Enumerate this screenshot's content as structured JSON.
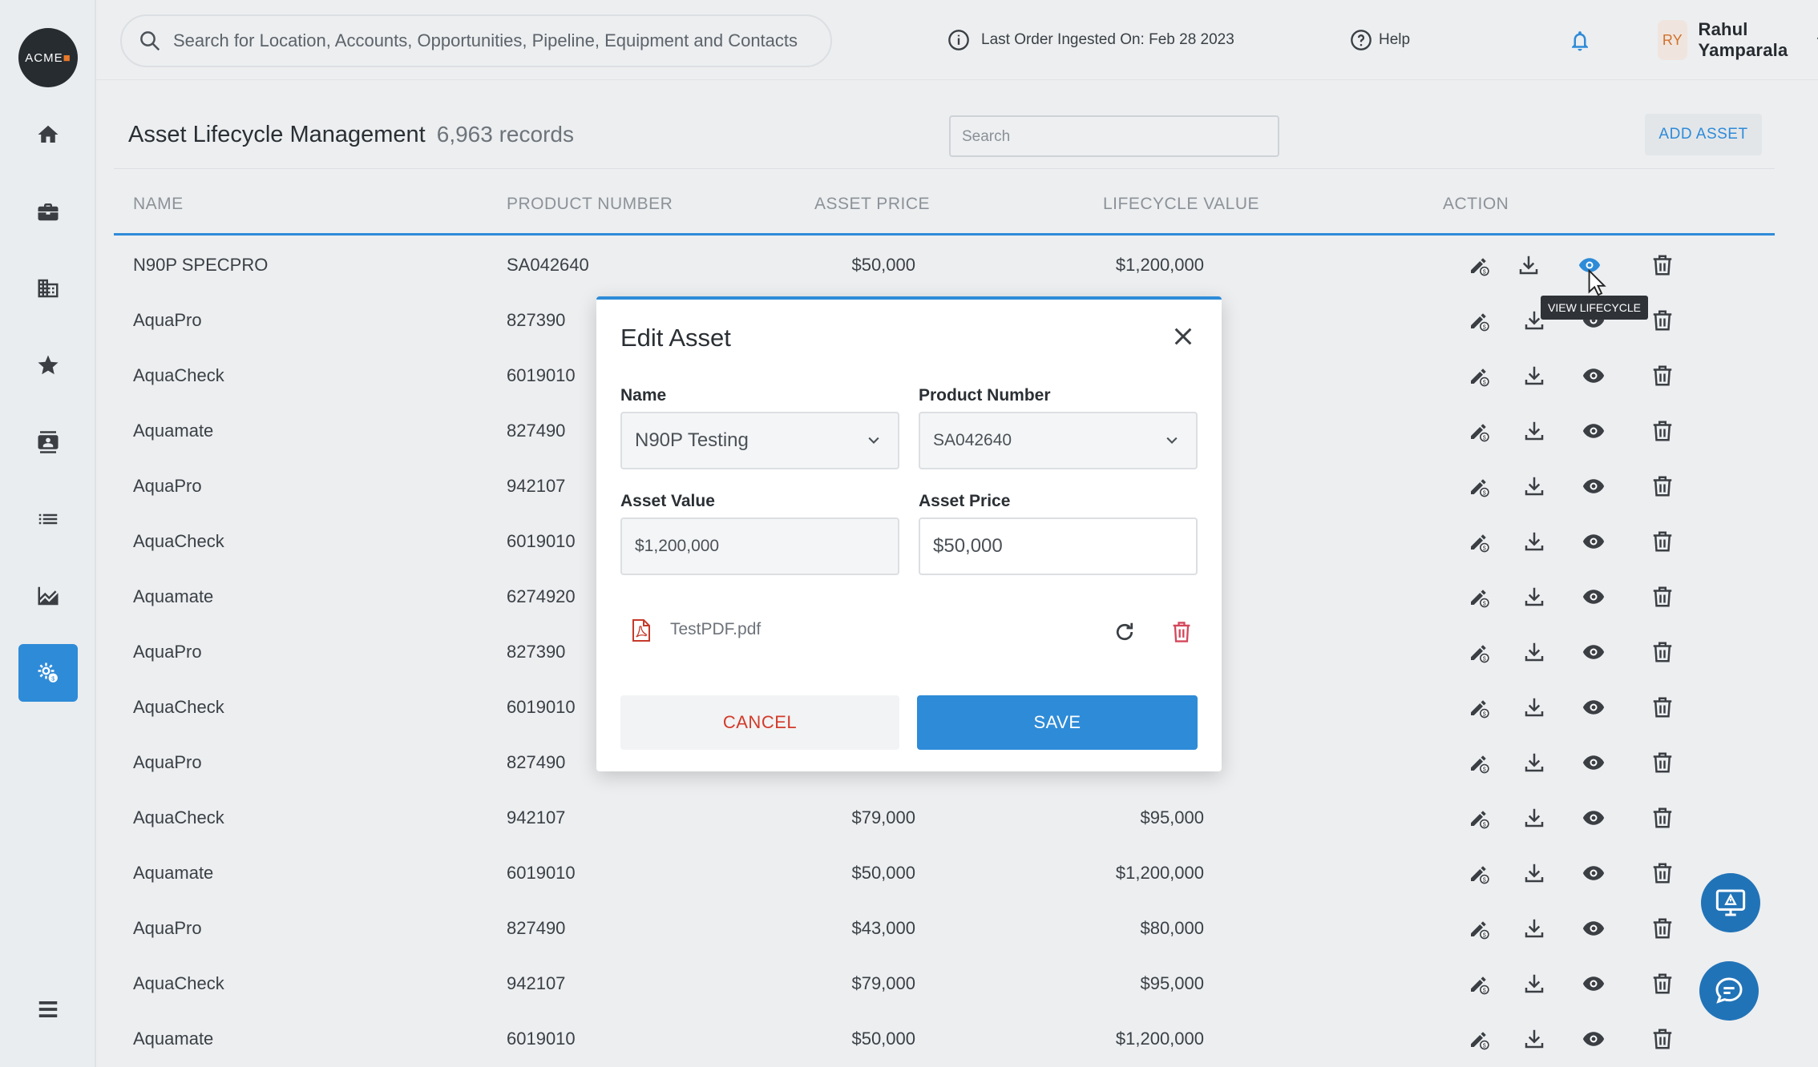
{
  "sidebar": {
    "logo_text": "ACME",
    "items": [
      {
        "icon": "home-icon"
      },
      {
        "icon": "briefcase-icon"
      },
      {
        "icon": "building-icon"
      },
      {
        "icon": "star-icon"
      },
      {
        "icon": "contacts-icon"
      },
      {
        "icon": "list-icon"
      },
      {
        "icon": "chart-icon"
      },
      {
        "icon": "asset-settings-icon",
        "active": true
      }
    ],
    "menu_icon": "menu-icon"
  },
  "topbar": {
    "search_placeholder": "Search for Location, Accounts, Opportunities, Pipeline, Equipment and Contacts",
    "ingest_text": "Last Order Ingested On: Feb 28 2023",
    "help_label": "Help",
    "user_initials": "RY",
    "user_name": "Rahul Yamparala"
  },
  "page": {
    "title": "Asset Lifecycle Management",
    "record_count": "6,963 records",
    "search_placeholder": "Search",
    "add_button": "ADD ASSET"
  },
  "table": {
    "columns": [
      "NAME",
      "PRODUCT NUMBER",
      "ASSET PRICE",
      "LIFECYCLE VALUE",
      "ACTION"
    ],
    "rows": [
      {
        "name": "N90P SPECPRO",
        "product": "SA042640",
        "price": "$50,000",
        "value": "$1,200,000"
      },
      {
        "name": "AquaPro",
        "product": "827390",
        "price": "",
        "value": ""
      },
      {
        "name": "AquaCheck",
        "product": "6019010",
        "price": "",
        "value": ""
      },
      {
        "name": "Aquamate",
        "product": "827490",
        "price": "",
        "value": ""
      },
      {
        "name": "AquaPro",
        "product": "942107",
        "price": "",
        "value": ""
      },
      {
        "name": "AquaCheck",
        "product": "6019010",
        "price": "",
        "value": ""
      },
      {
        "name": "Aquamate",
        "product": "6274920",
        "price": "",
        "value": ""
      },
      {
        "name": "AquaPro",
        "product": "827390",
        "price": "",
        "value": ""
      },
      {
        "name": "AquaCheck",
        "product": "6019010",
        "price": "",
        "value": ""
      },
      {
        "name": "AquaPro",
        "product": "827490",
        "price": "",
        "value": ""
      },
      {
        "name": "AquaCheck",
        "product": "942107",
        "price": "$79,000",
        "value": "$95,000"
      },
      {
        "name": "Aquamate",
        "product": "6019010",
        "price": "$50,000",
        "value": "$1,200,000"
      },
      {
        "name": "AquaPro",
        "product": "827490",
        "price": "$43,000",
        "value": "$80,000"
      },
      {
        "name": "AquaCheck",
        "product": "942107",
        "price": "$79,000",
        "value": "$95,000"
      },
      {
        "name": "Aquamate",
        "product": "6019010",
        "price": "$50,000",
        "value": "$1,200,000"
      }
    ]
  },
  "tooltip": "VIEW LIFECYCLE",
  "modal": {
    "title": "Edit Asset",
    "name_label": "Name",
    "name_value": "N90P Testing",
    "product_label": "Product Number",
    "product_value": "SA042640",
    "asset_value_label": "Asset Value",
    "asset_value": "$1,200,000",
    "asset_price_label": "Asset Price",
    "asset_price": "$50,000",
    "file_name": "TestPDF.pdf",
    "cancel_label": "CANCEL",
    "save_label": "SAVE"
  },
  "colors": {
    "accent": "#2e8bd8",
    "danger": "#d23b2a",
    "brand_dark": "#272c31"
  }
}
